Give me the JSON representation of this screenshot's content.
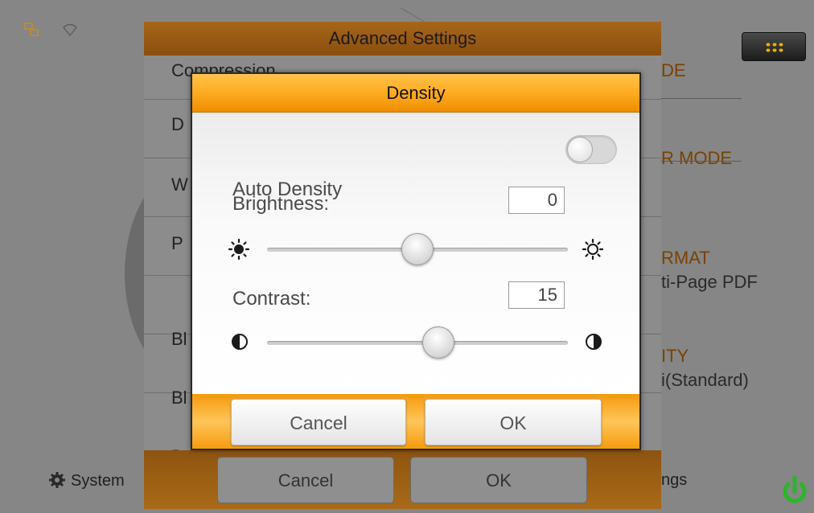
{
  "background": {
    "status_icons": [
      "network-icon",
      "wifi-icon"
    ],
    "right_options": [
      {
        "label": "DE",
        "sub": ""
      },
      {
        "label": "R MODE",
        "sub": ""
      },
      {
        "label": "RMAT",
        "sub": "ti-Page PDF"
      },
      {
        "label": "ITY",
        "sub": "i(Standard)"
      }
    ],
    "bottom_bar": {
      "system_label": "System",
      "settings_label": "ngs"
    }
  },
  "advanced_settings": {
    "title": "Advanced Settings",
    "rows": [
      "Compression",
      "D",
      "W",
      "P",
      "Bl",
      "Bl",
      "D"
    ],
    "cancel_label": "Cancel",
    "ok_label": "OK"
  },
  "density_dialog": {
    "title": "Density",
    "auto_density_label": "Auto Density",
    "auto_density_on": false,
    "brightness": {
      "label": "Brightness:",
      "value": "0",
      "slider_fraction": 0.5
    },
    "contrast": {
      "label": "Contrast:",
      "value": "15",
      "slider_fraction": 0.57
    },
    "cancel_label": "Cancel",
    "ok_label": "OK"
  },
  "colors": {
    "accent_orange": "#ffae26",
    "power_green": "#2bb52b"
  }
}
